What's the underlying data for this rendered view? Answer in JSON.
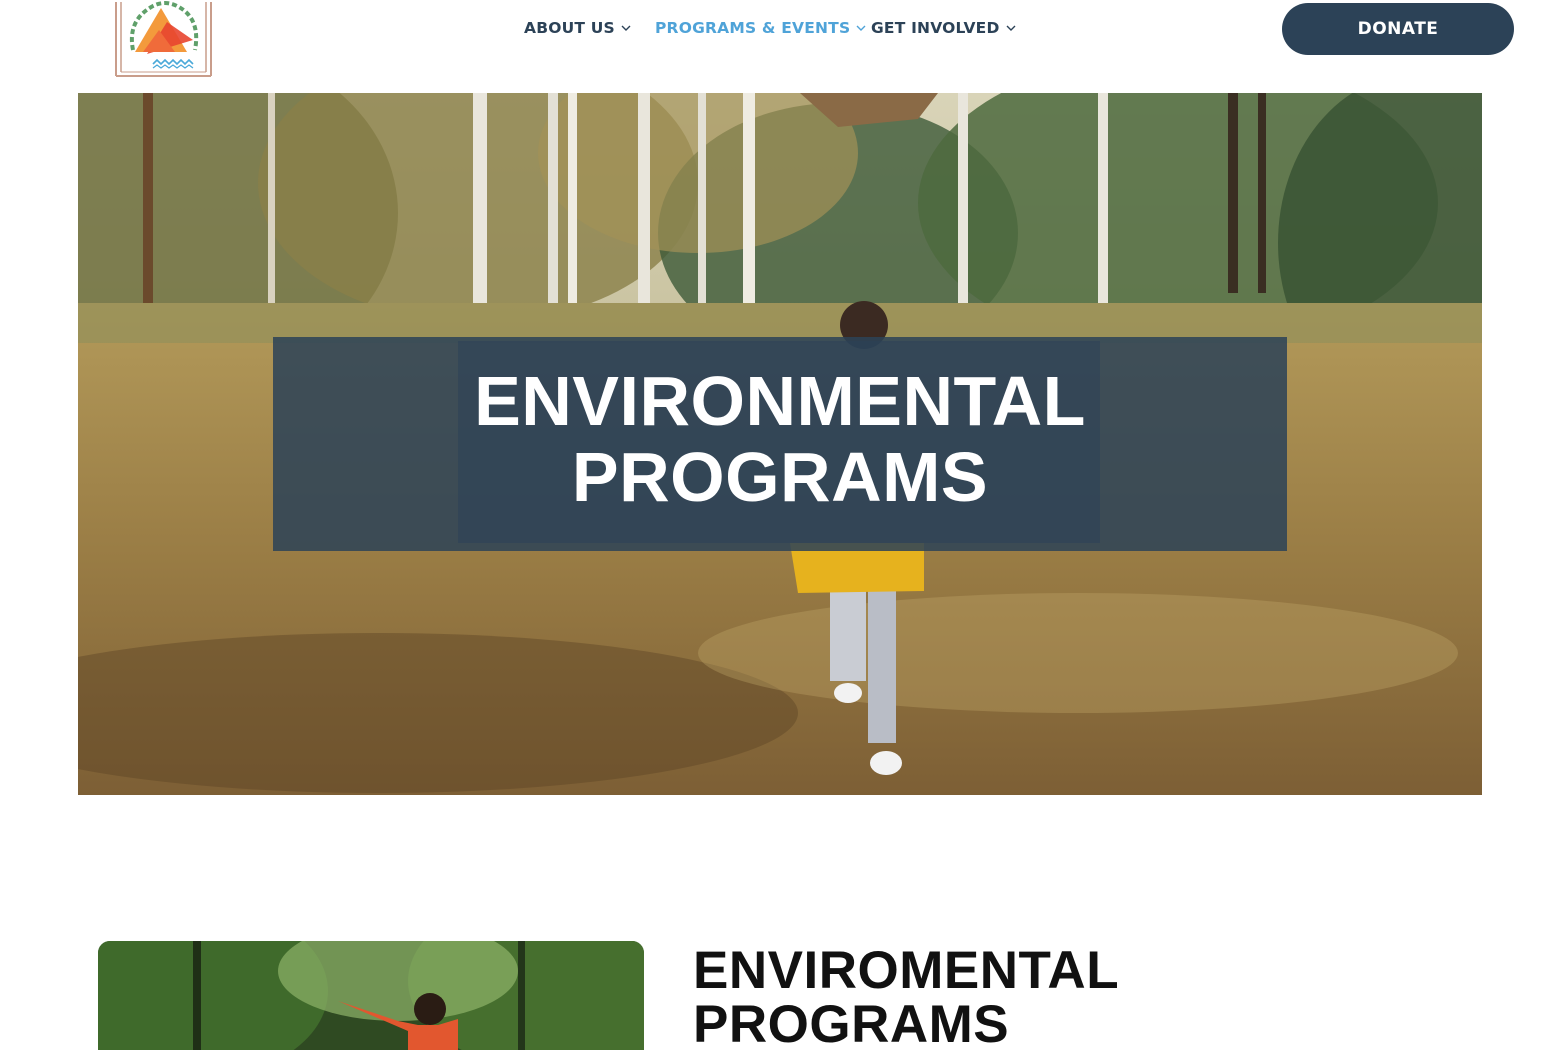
{
  "nav": {
    "items": [
      {
        "label": "ABOUT US",
        "active": false
      },
      {
        "label": "PROGRAMS & EVENTS",
        "active": true
      },
      {
        "label": "GET INVOLVED",
        "active": false
      }
    ],
    "donate_label": "DONATE"
  },
  "hero": {
    "title_line1": "ENVIRONMENTAL",
    "title_line2": "PROGRAMS"
  },
  "section": {
    "title_line1": "ENVIROMENTAL",
    "title_line2": "PROGRAMS"
  },
  "colors": {
    "brand_navy": "#2c4257",
    "nav_active": "#4fa3d8",
    "background": "#ffffff"
  },
  "icons": {
    "logo": "triangle-wreath-logo",
    "nav_chevron": "chevron-down-icon"
  }
}
